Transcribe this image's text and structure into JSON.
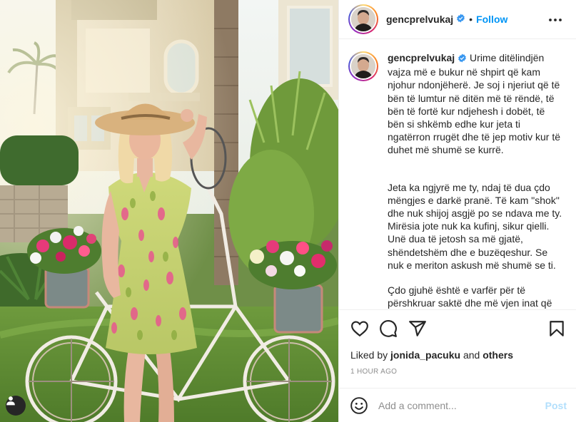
{
  "post": {
    "username": "gencprelvukaj",
    "verified": true,
    "separator": "•",
    "follow_label": "Follow",
    "more_icon": "more-options-icon",
    "caption": {
      "paragraphs": [
        "Urime ditëlindjën vajza më e bukur në shpirt që kam njohur ndonjëherë. Je soj i njeriut që të bën të lumtur në ditën më të rëndë, të bën të fortë kur ndjehesh i dobët, të bën si shkëmb edhe kur jeta ti ngatërron rrugët dhe të jep motiv kur të duhet më shumë se kurrë.",
        "Jeta ka ngjyrë me ty, ndaj të dua çdo mëngjes e darkë pranë. Të kam \"shok\" dhe nuk shijoj asgjë po se ndava me ty. Mirësia jote nuk ka kufinj, sikur qielli. Unë dua të jetosh sa më gjatë, shëndetshëm dhe e buzëqeshur. Se nuk e meriton askush më shumë se ti.",
        "Çdo gjuhë është e varfër për të përshkruar saktë dhe më vjen inat që nuk arrij ta kthej ndjenjën në fjalë. Të"
      ]
    },
    "actions": {
      "like_icon": "heart-icon",
      "comment_icon": "comment-icon",
      "share_icon": "share-icon",
      "save_icon": "bookmark-icon"
    },
    "likes": {
      "prefix": "Liked by",
      "user": "jonida_pacuku",
      "joiner": "and",
      "others": "others"
    },
    "timestamp": "1 HOUR AGO",
    "comment_box": {
      "emoji_icon": "emoji-icon",
      "placeholder": "Add a comment...",
      "post_label": "Post"
    },
    "photo": {
      "tag_icon": "user-tag-icon"
    }
  },
  "colors": {
    "accent": "#0095f6",
    "post_disabled": "#b2dffc",
    "verified": "#3897f0",
    "muted": "#8e8e8e"
  }
}
